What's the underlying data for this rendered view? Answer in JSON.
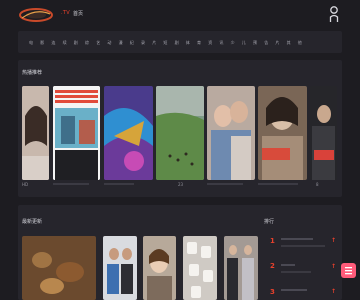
{
  "header": {
    "site_tag": ".TV",
    "nav_link": "首页",
    "accent": "#e8412c"
  },
  "categories": [
    "电",
    "影",
    "连",
    "续",
    "剧",
    "综",
    "艺",
    "动",
    "漫",
    "纪",
    "录",
    "片",
    "短",
    "剧",
    "体",
    "育",
    "资",
    "讯",
    "少",
    "儿",
    "预",
    "告",
    "片",
    "其",
    "他"
  ],
  "featured": {
    "title": "热播推荐",
    "cards": [
      {
        "caption": "",
        "badge": "HD"
      },
      {
        "caption": "",
        "overlay_text": "系统出柜的东北人 无聊婆婆家 没想到其中的 是这样的"
      },
      {
        "caption": ""
      },
      {
        "caption": "",
        "badge": "23"
      },
      {
        "caption": ""
      },
      {
        "caption": "",
        "overlay_text": "周雨中到"
      },
      {
        "caption": "",
        "overlay_text": "李小",
        "badge": "8"
      }
    ]
  },
  "latest": {
    "title": "最新更新",
    "rank_title": "排行",
    "rank_numbers": [
      "1",
      "2",
      "3"
    ],
    "rank_mark": "↑"
  },
  "float_button": {
    "icon": "menu-icon",
    "color": "#ff5b7a"
  }
}
